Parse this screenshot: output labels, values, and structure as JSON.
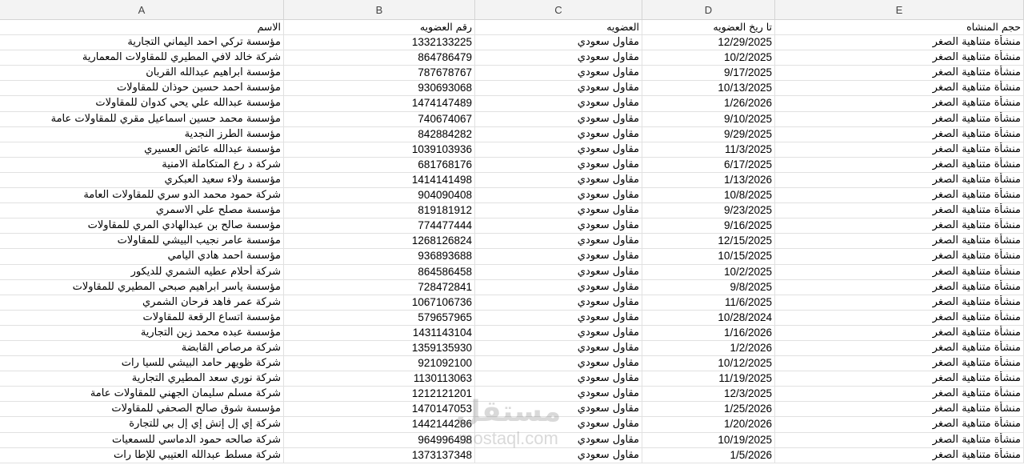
{
  "columns": [
    "A",
    "B",
    "C",
    "D",
    "E"
  ],
  "header_row": {
    "name": "الاسم",
    "number": "رقم العضويه",
    "membership": "العضويه",
    "date": "تا ريخ العضويه",
    "size": "حجم  المنشاه"
  },
  "rows": [
    {
      "name": "مؤسسة تركي احمد اليماني التجارية",
      "number": "1332133225",
      "membership": "مقاول سعودي",
      "date": "12/29/2025",
      "size": "منشأة متناهية الصغر"
    },
    {
      "name": "شركة خالد لافي المطيري للمقاولات المعمارية",
      "number": "864786479",
      "membership": "مقاول سعودي",
      "date": "10/2/2025",
      "size": "منشأة متناهية الصغر"
    },
    {
      "name": "مؤسسة ابراهيم عبدالله القربان",
      "number": "787678767",
      "membership": "مقاول سعودي",
      "date": "9/17/2025",
      "size": "منشأة متناهية الصغر"
    },
    {
      "name": "مؤسسة احمد حسين حوذان للمقاولات",
      "number": "930693068",
      "membership": "مقاول سعودي",
      "date": "10/13/2025",
      "size": "منشأة متناهية الصغر"
    },
    {
      "name": "مؤسسة عبدالله علي يحي كدوان للمقاولات",
      "number": "1474147489",
      "membership": "مقاول سعودي",
      "date": "1/26/2026",
      "size": "منشأة متناهية الصغر"
    },
    {
      "name": "مؤسسة محمد حسين اسماعيل مقري للمقاولات عامة",
      "number": "740674067",
      "membership": "مقاول سعودي",
      "date": "9/10/2025",
      "size": "منشأة متناهية الصغر"
    },
    {
      "name": "مؤسسة الطرز النجدية",
      "number": "842884282",
      "membership": "مقاول سعودي",
      "date": "9/29/2025",
      "size": "منشأة متناهية الصغر"
    },
    {
      "name": "مؤسسة عبدالله عائض العسيري",
      "number": "1039103936",
      "membership": "مقاول سعودي",
      "date": "11/3/2025",
      "size": "منشأة متناهية الصغر"
    },
    {
      "name": "شركة د رع المتكاملة الامنية",
      "number": "681768176",
      "membership": "مقاول سعودي",
      "date": "6/17/2025",
      "size": "منشأة متناهية الصغر"
    },
    {
      "name": "مؤسسة ولاء سعيد العبكري",
      "number": "1414141498",
      "membership": "مقاول سعودي",
      "date": "1/13/2026",
      "size": "منشأة متناهية الصغر"
    },
    {
      "name": "شركة حمود محمد الدو سري للمقاولات العامة",
      "number": "904090408",
      "membership": "مقاول سعودي",
      "date": "10/8/2025",
      "size": "منشأة متناهية الصغر"
    },
    {
      "name": "مؤسسة مصلح علي الاسمري",
      "number": "819181912",
      "membership": "مقاول سعودي",
      "date": "9/23/2025",
      "size": "منشأة متناهية الصغر"
    },
    {
      "name": "مؤسسة صالح بن عبدالهادي المري للمقاولات",
      "number": "774477444",
      "membership": "مقاول سعودي",
      "date": "9/16/2025",
      "size": "منشأة متناهية الصغر"
    },
    {
      "name": "مؤسسة عامر نجيب البيشي للمقاولات",
      "number": "1268126824",
      "membership": "مقاول سعودي",
      "date": "12/15/2025",
      "size": "منشأة متناهية الصغر"
    },
    {
      "name": "مؤسسة احمد هادي اليامي",
      "number": "936893688",
      "membership": "مقاول سعودي",
      "date": "10/15/2025",
      "size": "منشأة متناهية الصغر"
    },
    {
      "name": "شركة أحلام عطيه الشمري للديكور",
      "number": "864586458",
      "membership": "مقاول سعودي",
      "date": "10/2/2025",
      "size": "منشأة متناهية الصغر"
    },
    {
      "name": "مؤسسة ياسر ابراهيم صبحي المطيري للمقاولات",
      "number": "728472841",
      "membership": "مقاول سعودي",
      "date": "9/8/2025",
      "size": "منشأة متناهية الصغر"
    },
    {
      "name": "شركة عمر فاهد فرحان الشمري",
      "number": "1067106736",
      "membership": "مقاول سعودي",
      "date": "11/6/2025",
      "size": "منشأة متناهية الصغر"
    },
    {
      "name": "مؤسسة اتساع الرقعة للمقاولات",
      "number": "579657965",
      "membership": "مقاول سعودي",
      "date": "10/28/2024",
      "size": "منشأة متناهية الصغر"
    },
    {
      "name": "مؤسسة عبده محمد  زين التجارية",
      "number": "1431143104",
      "membership": "مقاول سعودي",
      "date": "1/16/2026",
      "size": "منشأة متناهية الصغر"
    },
    {
      "name": "شركة مرصاص القابضة",
      "number": "1359135930",
      "membership": "مقاول سعودي",
      "date": "1/2/2026",
      "size": "منشأة متناهية الصغر"
    },
    {
      "name": "شركة ظويهر حامد البيشي للسيا رات",
      "number": "921092100",
      "membership": "مقاول سعودي",
      "date": "10/12/2025",
      "size": "منشأة متناهية الصغر"
    },
    {
      "name": "شركة نوري سعد المطيري التجارية",
      "number": "1130113063",
      "membership": "مقاول سعودي",
      "date": "11/19/2025",
      "size": "منشأة متناهية الصغر"
    },
    {
      "name": "شركة مسلم سليمان الجهني للمقاولات عامة",
      "number": "1212121201",
      "membership": "مقاول سعودي",
      "date": "12/3/2025",
      "size": "منشأة متناهية الصغر"
    },
    {
      "name": "مؤسسة شوق صالح الصحفي للمقاولات",
      "number": "1470147053",
      "membership": "مقاول سعودي",
      "date": "1/25/2026",
      "size": "منشأة متناهية الصغر"
    },
    {
      "name": "شركة إي إل إتش إي إل بي للتجارة",
      "number": "1442144286",
      "membership": "مقاول سعودي",
      "date": "1/20/2026",
      "size": "منشأة متناهية الصغر"
    },
    {
      "name": "شركة صالحه حمود الدماسي للسمعيات",
      "number": "964996498",
      "membership": "مقاول سعودي",
      "date": "10/19/2025",
      "size": "منشأة متناهية الصغر"
    },
    {
      "name": "شركة مسلط عبدالله العتيبي للإطا رات",
      "number": "1373137348",
      "membership": "مقاول سعودي",
      "date": "1/5/2026",
      "size": "منشأة متناهية الصغر"
    }
  ],
  "watermark": {
    "logo": "مستقل",
    "site": "mostaql.com"
  },
  "colors": {
    "header_bg": "#f3f3f3",
    "grid": "#e1e1e1"
  }
}
